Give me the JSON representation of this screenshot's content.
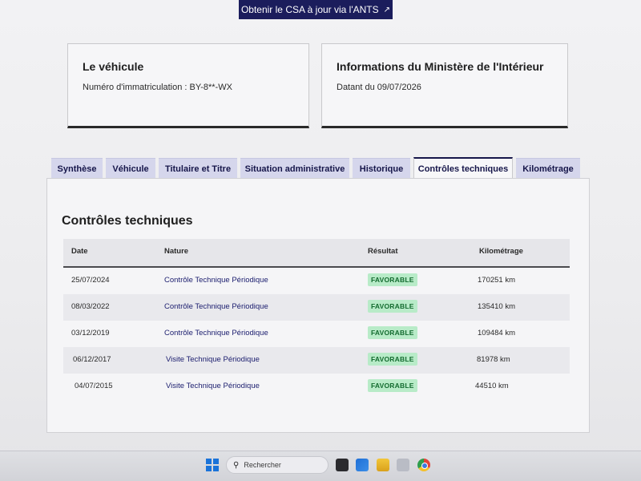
{
  "top_button": {
    "label": "Obtenir le CSA à jour via l'ANTS",
    "icon": "external-link-icon"
  },
  "vehicle_card": {
    "title": "Le véhicule",
    "registration_label": "Numéro d'immatriculation : BY-8**-WX"
  },
  "ministry_card": {
    "title": "Informations du Ministère de l'Intérieur",
    "date_label": "Datant du 09/07/2026"
  },
  "tabs": [
    {
      "label": "Synthèse"
    },
    {
      "label": "Véhicule"
    },
    {
      "label": "Titulaire et Titre"
    },
    {
      "label": "Situation administrative"
    },
    {
      "label": "Historique"
    },
    {
      "label": "Contrôles techniques",
      "active": true
    },
    {
      "label": "Kilométrage"
    }
  ],
  "section": {
    "title": "Contrôles techniques",
    "columns": {
      "date": "Date",
      "nature": "Nature",
      "result": "Résultat",
      "mileage": "Kilométrage"
    },
    "rows": [
      {
        "date": "25/07/2024",
        "nature": "Contrôle Technique Périodique",
        "result": "FAVORABLE",
        "mileage": "170251 km"
      },
      {
        "date": "08/03/2022",
        "nature": "Contrôle Technique Périodique",
        "result": "FAVORABLE",
        "mileage": "135410 km"
      },
      {
        "date": "03/12/2019",
        "nature": "Contrôle Technique Périodique",
        "result": "FAVORABLE",
        "mileage": "109484 km"
      },
      {
        "date": "06/12/2017",
        "nature": "Visite Technique Périodique",
        "result": "FAVORABLE",
        "mileage": "81978 km"
      },
      {
        "date": "04/07/2015",
        "nature": "Visite Technique Périodique",
        "result": "FAVORABLE",
        "mileage": "44510 km"
      }
    ]
  },
  "taskbar": {
    "search_label": "Rechercher",
    "icons": [
      "windows-start-icon",
      "search-icon",
      "widgets-icon",
      "store-icon",
      "file-explorer-icon",
      "files-icon",
      "chrome-icon"
    ]
  },
  "colors": {
    "primary": "#1b1d5c",
    "tab_bg": "#d5d6ec",
    "badge_bg": "#b8ebc8",
    "badge_text": "#136b2f"
  }
}
